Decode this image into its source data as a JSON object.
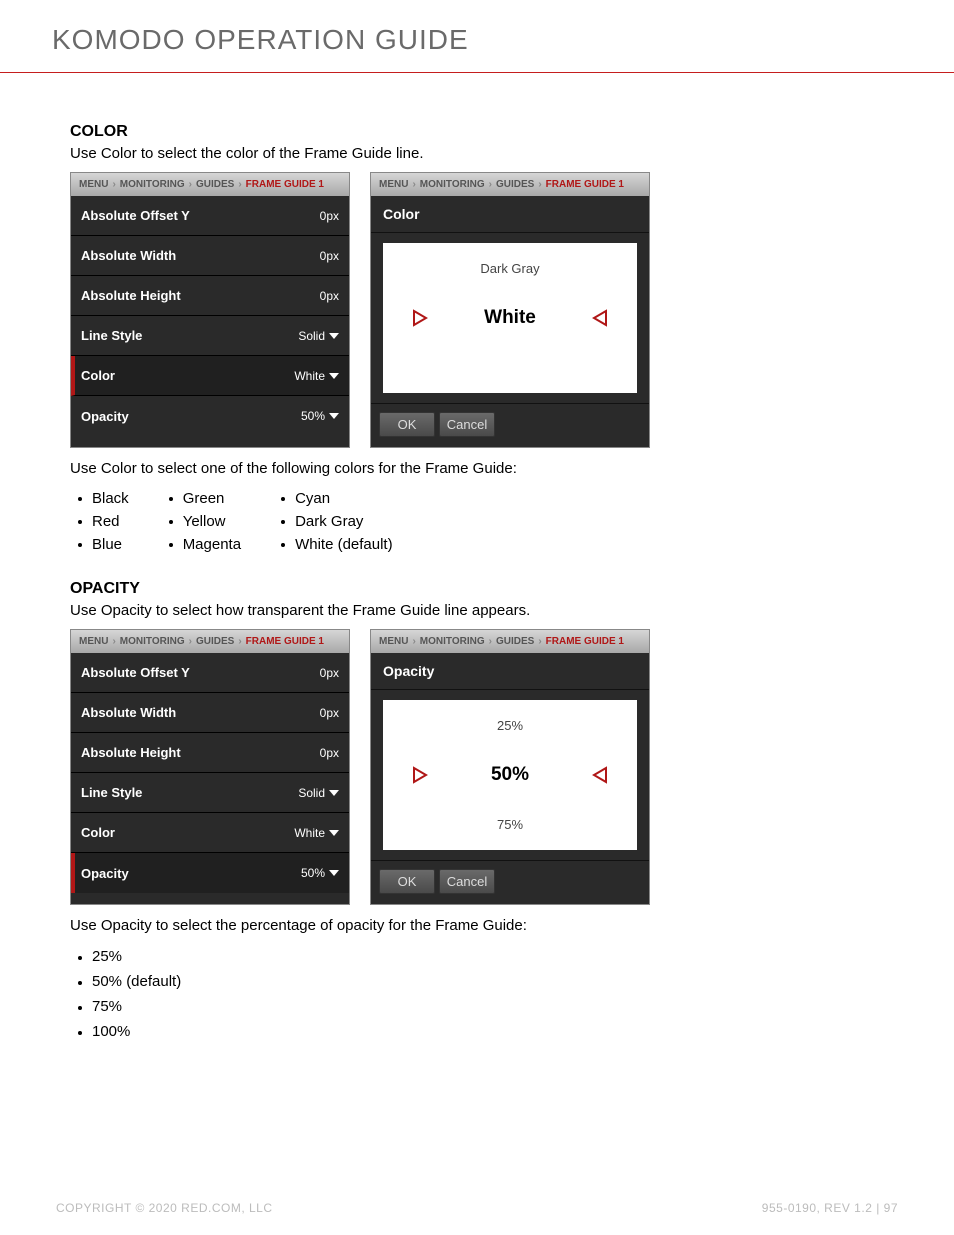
{
  "header": {
    "title": "KOMODO OPERATION GUIDE"
  },
  "breadcrumbs": {
    "parts": [
      "MENU",
      "MONITORING",
      "GUIDES"
    ],
    "current": "FRAME GUIDE 1"
  },
  "menu_rows": [
    {
      "label": "Absolute Offset Y",
      "value": "0px",
      "dropdown": false
    },
    {
      "label": "Absolute Width",
      "value": "0px",
      "dropdown": false
    },
    {
      "label": "Absolute Height",
      "value": "0px",
      "dropdown": false
    },
    {
      "label": "Line Style",
      "value": "Solid",
      "dropdown": true
    },
    {
      "label": "Color",
      "value": "White",
      "dropdown": true
    },
    {
      "label": "Opacity",
      "value": "50%",
      "dropdown": true
    }
  ],
  "color_section": {
    "heading": "COLOR",
    "intro": "Use Color to select the color of the Frame Guide line.",
    "note": "Use Color to select one of the following colors for the Frame Guide:",
    "picker": {
      "title": "Color",
      "prev": "Dark Gray",
      "current": "White",
      "next": ""
    },
    "active_row": "Color",
    "color_options_col1": [
      "Black",
      "Red",
      "Blue"
    ],
    "color_options_col2": [
      "Green",
      "Yellow",
      "Magenta"
    ],
    "color_options_col3": [
      "Cyan",
      "Dark Gray",
      "White (default)"
    ]
  },
  "opacity_section": {
    "heading": "OPACITY",
    "intro": "Use Opacity to select how transparent the Frame Guide line appears.",
    "note": "Use Opacity to select the percentage of opacity for the Frame Guide:",
    "picker": {
      "title": "Opacity",
      "prev": "25%",
      "current": "50%",
      "next": "75%"
    },
    "active_row": "Opacity",
    "options": [
      "25%",
      "50% (default)",
      "75%",
      "100%"
    ]
  },
  "buttons": {
    "ok": "OK",
    "cancel": "Cancel"
  },
  "footer": {
    "left": "COPYRIGHT © 2020 RED.COM, LLC",
    "right": "955-0190, REV 1.2  |  97"
  }
}
